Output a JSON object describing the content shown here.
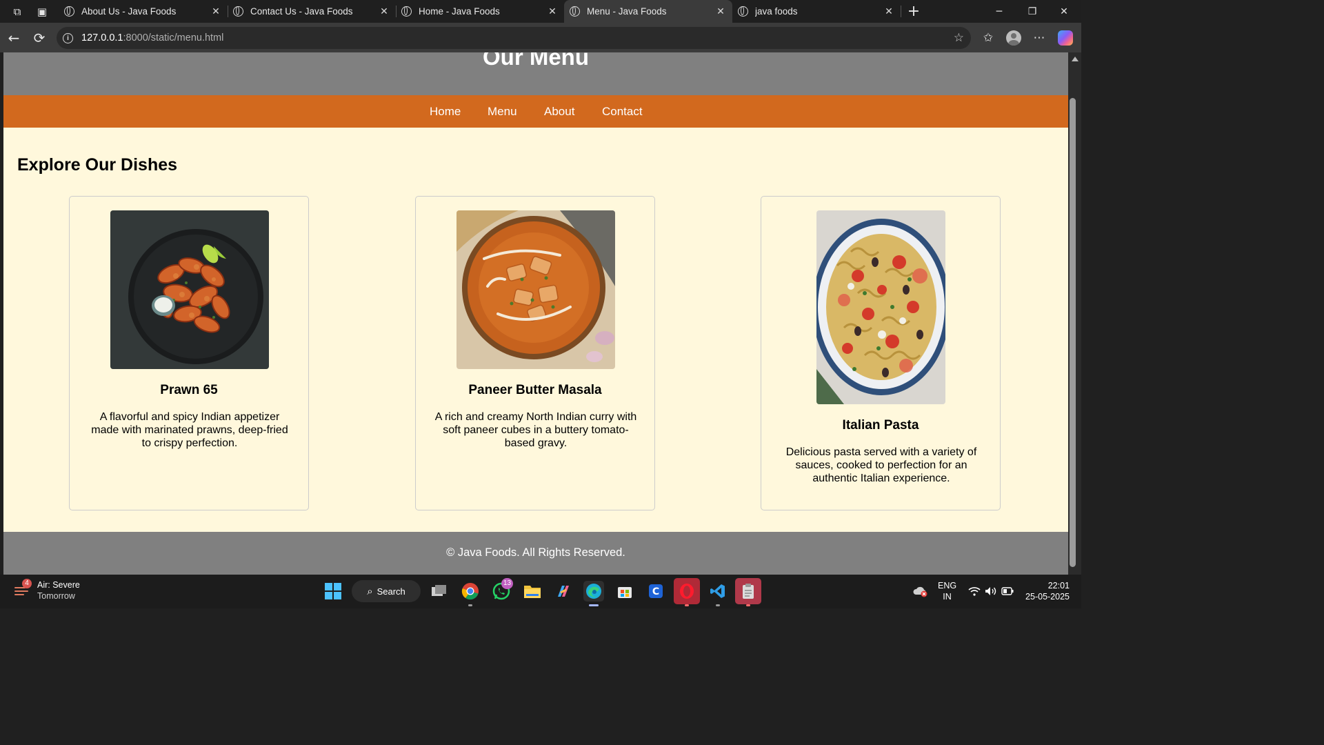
{
  "browser": {
    "tabs": [
      {
        "title": "About Us - Java Foods",
        "active": false
      },
      {
        "title": "Contact Us - Java Foods",
        "active": false
      },
      {
        "title": "Home - Java Foods",
        "active": false
      },
      {
        "title": "Menu - Java Foods",
        "active": true
      },
      {
        "title": "java foods",
        "active": false
      }
    ],
    "tab_close_glyph": "✕",
    "new_tab_glyph": "+",
    "window_controls": {
      "minimize": "─",
      "maximize": "❐",
      "close": "✕"
    },
    "address": {
      "host": "127.0.0.1",
      "path": ":8000/static/menu.html"
    },
    "icons": [
      "workspaces-icon",
      "tab-actions-icon",
      "back-icon",
      "refresh-icon",
      "site-info-icon",
      "favorite-star-icon",
      "favorites-icon",
      "profile-icon",
      "more-icon",
      "copilot-icon"
    ]
  },
  "page": {
    "header_title": "Our Menu",
    "nav": [
      {
        "label": "Home"
      },
      {
        "label": "Menu"
      },
      {
        "label": "About"
      },
      {
        "label": "Contact"
      }
    ],
    "section_title": "Explore Our Dishes",
    "dishes": [
      {
        "name": "Prawn 65",
        "description": "A flavorful and spicy Indian appetizer made with marinated prawns, deep-fried to crispy perfection."
      },
      {
        "name": "Paneer Butter Masala",
        "description": "A rich and creamy North Indian curry with soft paneer cubes in a buttery tomato-based gravy."
      },
      {
        "name": "Italian Pasta",
        "description": "Delicious pasta served with a variety of sauces, cooked to perfection for an authentic Italian experience."
      }
    ],
    "footer": "© Java Foods. All Rights Reserved.",
    "colors": {
      "header": "#808080",
      "nav": "#d2691e",
      "background": "#fff8dc"
    }
  },
  "taskbar": {
    "weather": {
      "badge": "4",
      "line1": "Air: Severe",
      "line2": "Tomorrow"
    },
    "search_label": "Search",
    "whatsapp_badge": "13",
    "language": {
      "line1": "ENG",
      "line2": "IN"
    },
    "clock": {
      "time": "22:01",
      "date": "25-05-2025"
    }
  }
}
